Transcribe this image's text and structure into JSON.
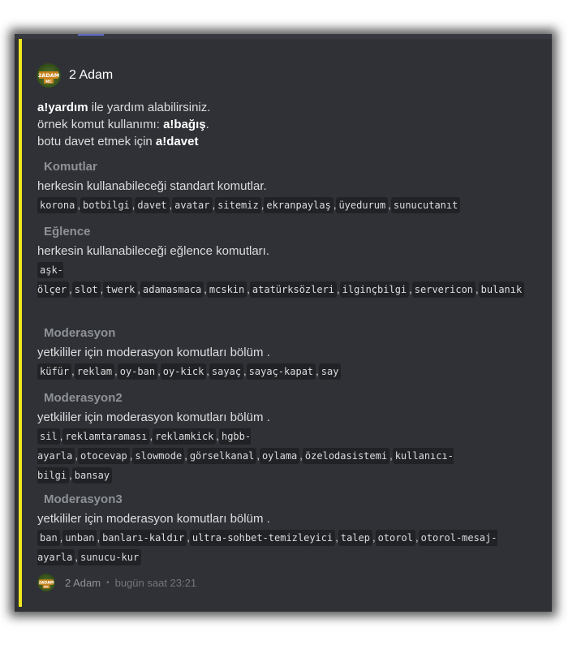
{
  "embed": {
    "accent_color": "#f0e61e",
    "author": {
      "name": "2 Adam",
      "avatar_icon": "2adam-mc-logo-icon"
    },
    "description": [
      {
        "bold": "a!yardım",
        "rest": " ile yardım alabilirsiniz."
      },
      {
        "plain": "örnek komut kullanımı: ",
        "bold": "a!bağış",
        "rest": "."
      },
      {
        "plain": "botu davet etmek için ",
        "bold": "a!davet"
      }
    ],
    "fields": [
      {
        "name": "Komutlar",
        "value": "herkesin kullanabileceği standart komutlar.",
        "commands": [
          "korona",
          "botbilgi",
          "davet",
          "avatar",
          "sitemiz",
          "ekranpaylaş",
          "üyedurum",
          "sunucutanıt"
        ]
      },
      {
        "name": "Eğlence",
        "value": "herkesin kullanabileceği eğlence komutları.",
        "commands": [
          "aşk-ölçer",
          "slot",
          "twerk",
          "adamasmaca",
          "mcskin",
          "atatürksözleri",
          "ilginçbilgi",
          "servericon",
          "bulanık"
        ]
      },
      {
        "name": "Moderasyon",
        "value": "yetkililer için moderasyon komutları bölüm .",
        "commands": [
          "küfür",
          "reklam",
          "oy-ban",
          "oy-kick",
          "sayaç",
          "sayaç-kapat",
          "say"
        ]
      },
      {
        "name": "Moderasyon2",
        "value": "yetkililer için moderasyon komutları bölüm .",
        "commands": [
          "sil",
          "reklamtaraması",
          "reklamkick",
          "hgbb-ayarla",
          "otocevap",
          "slowmode",
          "görselkanal",
          "oylama",
          "özelodasistemi",
          "kullanıcı-bilgi",
          "bansay"
        ]
      },
      {
        "name": "Moderasyon3",
        "value": "yetkililer için moderasyon komutları bölüm .",
        "commands": [
          "ban",
          "unban",
          "banları-kaldır",
          "ultra-sohbet-temizleyici",
          "talep",
          "otorol",
          "otorol-mesaj-ayarla",
          "sunucu-kur"
        ]
      }
    ],
    "footer": {
      "name": "2 Adam",
      "separator": "•",
      "time": "bugün saat 23:21"
    }
  }
}
